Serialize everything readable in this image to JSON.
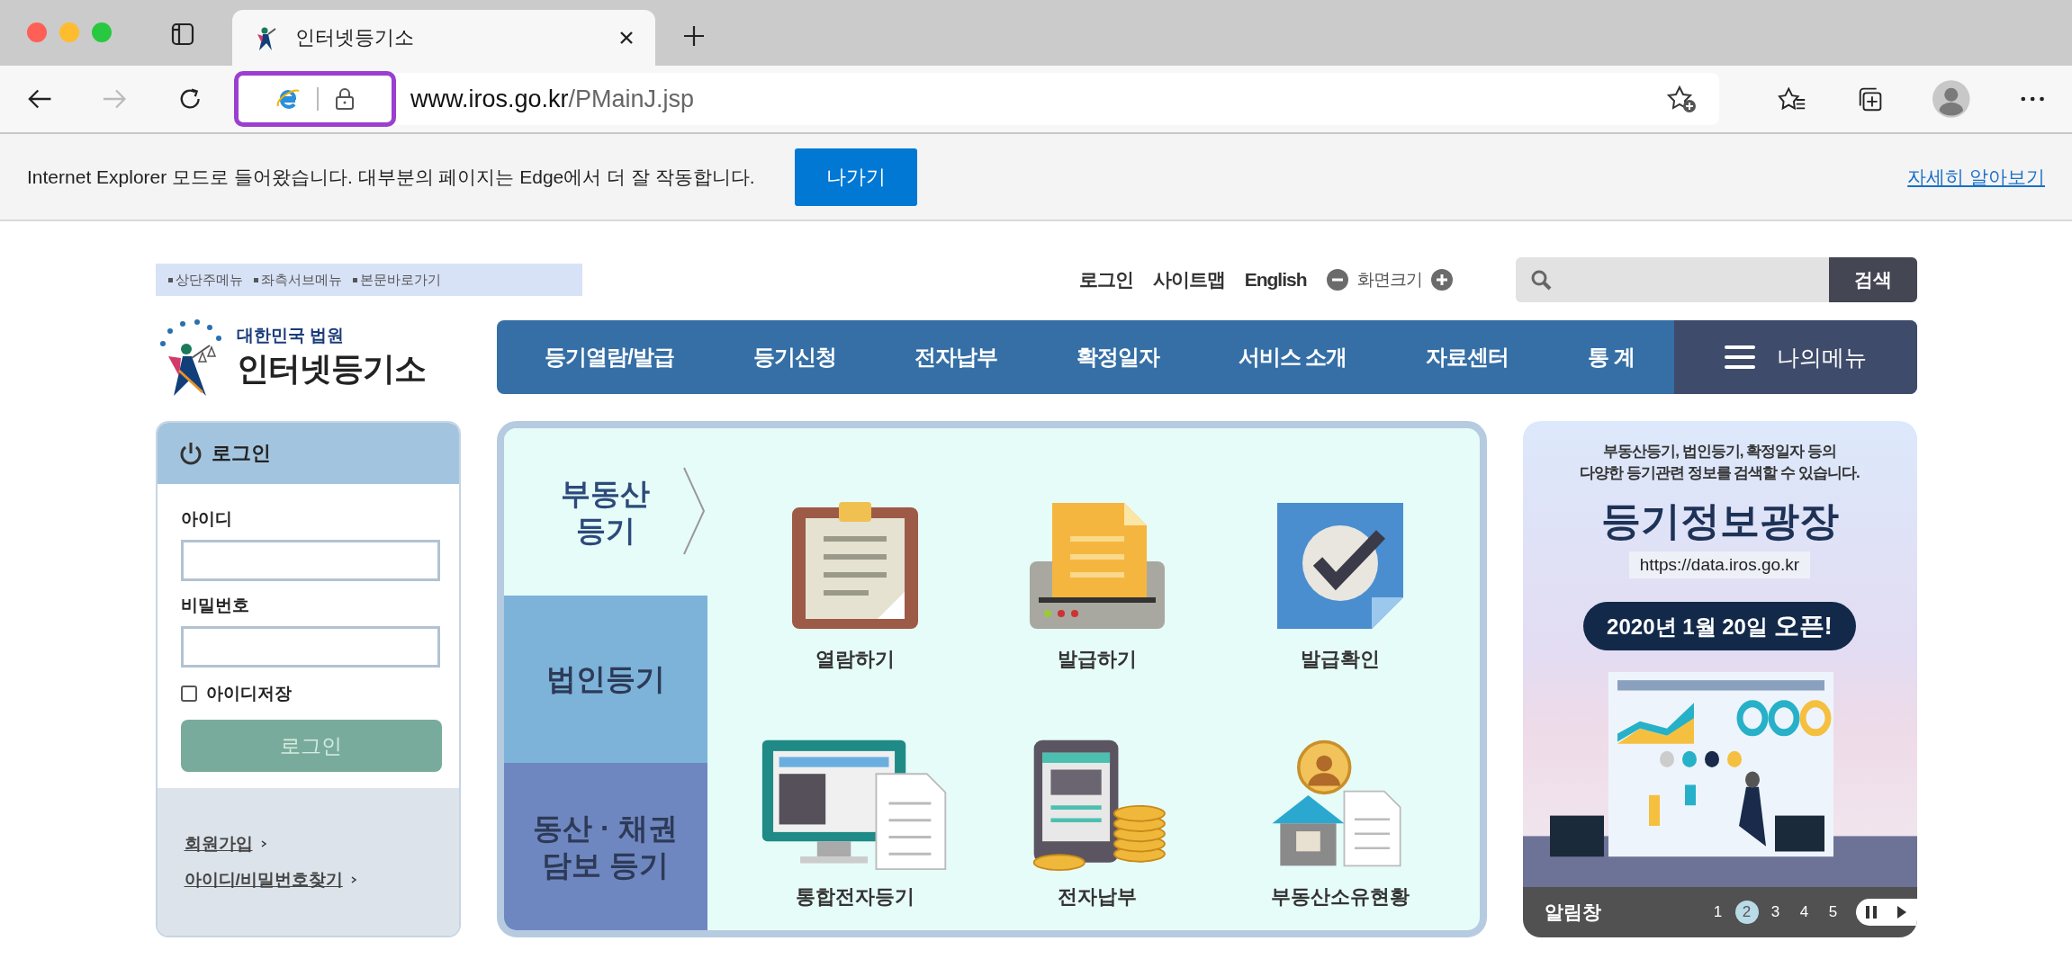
{
  "browser": {
    "tab": {
      "title": "인터넷등기소"
    },
    "url": {
      "host": "www.iros.go.kr",
      "path": "/PMainJ.jsp"
    },
    "infobar": {
      "message": "Internet Explorer 모드로 들어왔습니다. 대부분의 페이지는 Edge에서 더 잘 작동합니다.",
      "button": "나가기",
      "link": "자세히 알아보기"
    }
  },
  "header": {
    "skip_links": [
      "상단주메뉴",
      "좌측서브메뉴",
      "본문바로가기"
    ],
    "util_links": [
      "로그인",
      "사이트맵",
      "English"
    ],
    "font_size": "화면크기",
    "search": {
      "button": "검색"
    },
    "logo": {
      "org": "대한민국 법원",
      "name": "인터넷등기소"
    },
    "nav": [
      "등기열람/발급",
      "등기신청",
      "전자납부",
      "확정일자",
      "서비스 소개",
      "자료센터",
      "통 계"
    ],
    "my_menu": "나의메뉴"
  },
  "login": {
    "title": "로그인",
    "id_label": "아이디",
    "pw_label": "비밀번호",
    "remember": {
      "label": "아이디저장",
      "checked": false
    },
    "button": "로그인",
    "links": [
      "회원가입",
      "아이디/비밀번호찾기"
    ]
  },
  "categories": [
    {
      "lines": [
        "부동산",
        "등기"
      ],
      "selected": true,
      "color": "#e6fcf8"
    },
    {
      "lines": [
        "법인등기"
      ],
      "selected": false,
      "color": "#7db3d8"
    },
    {
      "lines": [
        "동산 · 채권",
        "담보 등기"
      ],
      "selected": false,
      "color": "#6f87c0"
    }
  ],
  "services": [
    {
      "label": "열람하기",
      "kind": "clipboard"
    },
    {
      "label": "발급하기",
      "kind": "printer"
    },
    {
      "label": "발급확인",
      "kind": "check"
    },
    {
      "label": "통합전자등기",
      "kind": "monitor"
    },
    {
      "label": "전자납부",
      "kind": "coins"
    },
    {
      "label": "부동산소유현황",
      "kind": "house"
    }
  ],
  "banner": {
    "intro": [
      "부동산등기, 법인등기, 확정일자 등의",
      "다양한 등기관련 정보를 검색할 수 있습니다."
    ],
    "title": "등기정보광장",
    "url": "https://data.iros.go.kr",
    "date": "2020년 1월 20일 **오픈!**",
    "footer": "알림창",
    "pages": [
      {
        "label": "1",
        "selected": false
      },
      {
        "label": "2",
        "selected": true
      },
      {
        "label": "3",
        "selected": false
      },
      {
        "label": "4",
        "selected": false
      },
      {
        "label": "5",
        "selected": false
      }
    ]
  }
}
